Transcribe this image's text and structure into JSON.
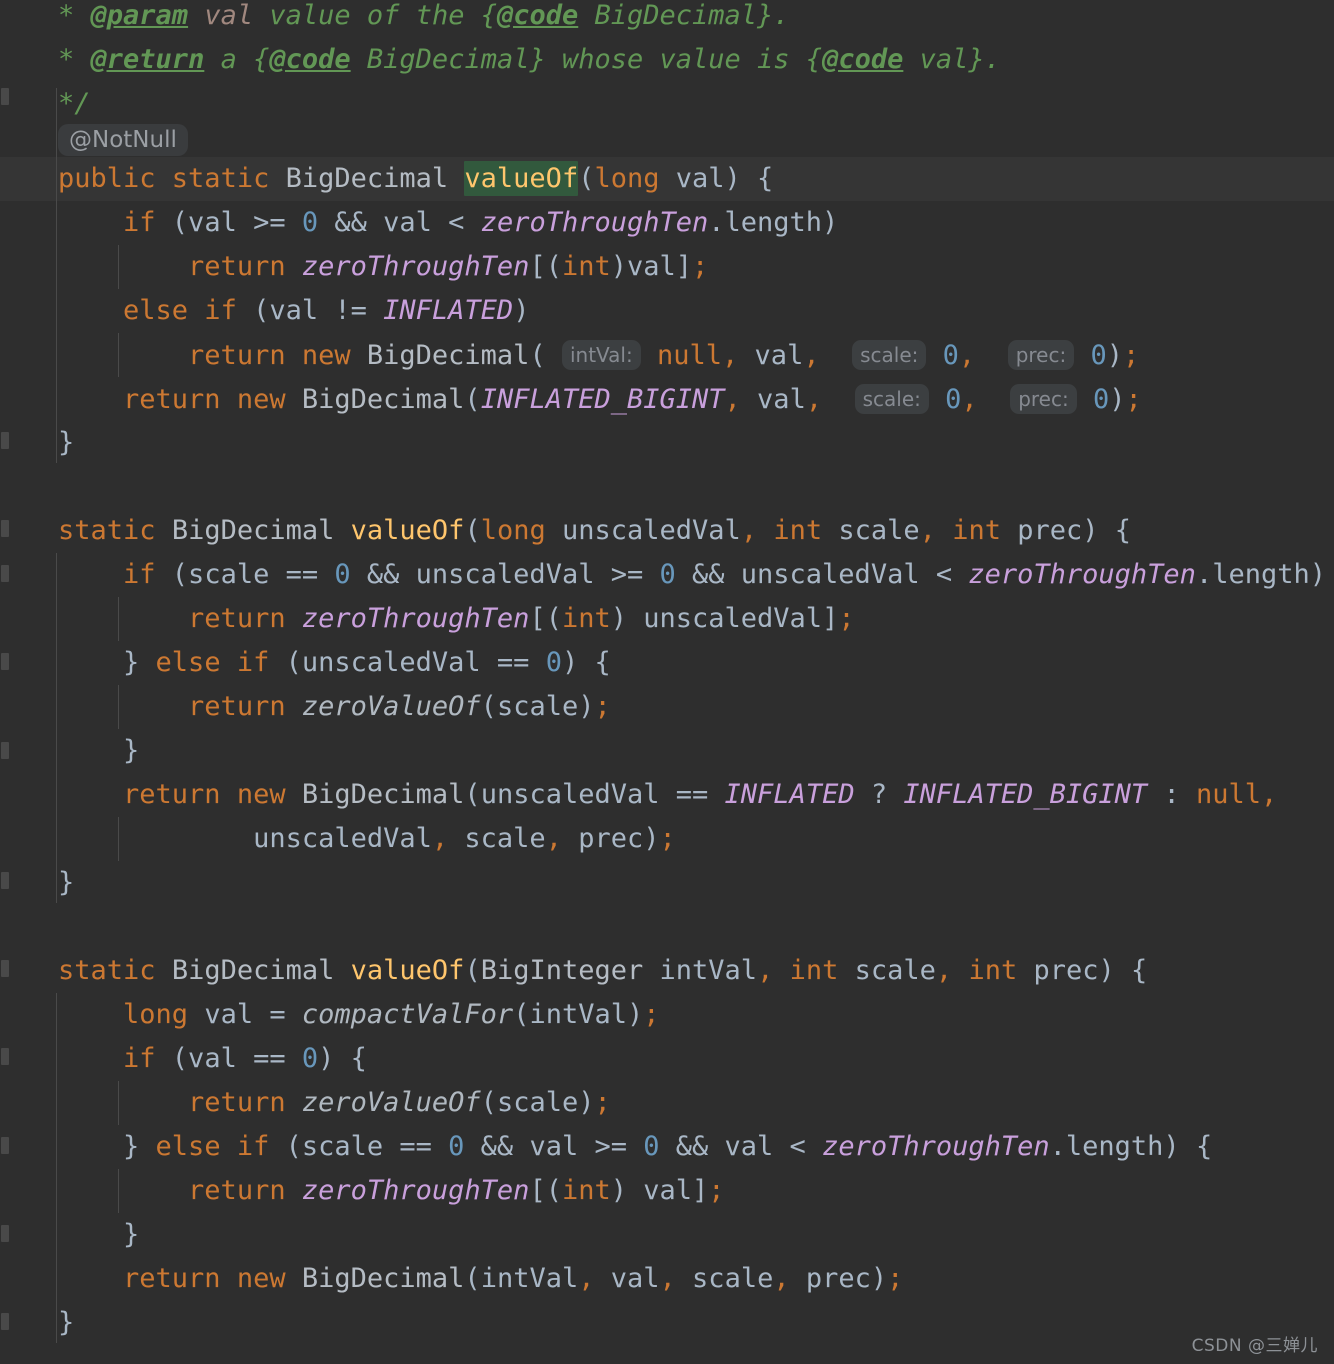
{
  "editor": {
    "theme": "darcula-dark",
    "background": "#2e2e2e",
    "caret_line_background": "#353535",
    "font_size_px": 27,
    "line_height_px": 44,
    "language": "Java",
    "file_context": "java.math.BigDecimal"
  },
  "colors": {
    "keyword": "#cc7832",
    "class_name": "#b5bcc4",
    "method_declaration": "#ffc66d",
    "static_field": "#c9a0dc",
    "static_method": "#b0b8c0",
    "number": "#6897bb",
    "comment": "#629755",
    "javadoc_param": "#a1887f",
    "plain_text": "#a9b7c6",
    "usage_highlight": "#32593d",
    "inlay_background": "#3c3f41",
    "inlay_text": "#868a91",
    "indent_guide": "#4a4a4a",
    "gutter_marker": "#5a5a5a"
  },
  "inlay_hints": {
    "annotation": "@NotNull",
    "param_intVal": "intVal:",
    "param_scale": "scale:",
    "param_prec": "prec:"
  },
  "code": {
    "javadoc": {
      "line1_star": "*",
      "line1_tag": "@param",
      "line1_param": "val",
      "line1_text_a": "value of the {",
      "line1_code_tag": "@code",
      "line1_text_b": " BigDecimal}.",
      "line2_star": "*",
      "line2_tag": "@return",
      "line2_text_a": "a {",
      "line2_code_tag": "@code",
      "line2_text_b": " BigDecimal} whose value is {",
      "line2_code_tag2": "@code",
      "line2_text_c": " val}.",
      "line3_close": "*/"
    },
    "method1": {
      "signature_modifiers": "public static ",
      "signature_type": "BigDecimal ",
      "signature_name": "valueOf",
      "signature_params": "(long val) {",
      "body": [
        "if (val >= 0 && val < zeroThroughTen.length)",
        "return zeroThroughTen[(int)val];",
        "else if (val != INFLATED)",
        "return new BigDecimal( intVal: null, val, scale: 0, prec: 0);",
        "return new BigDecimal(INFLATED_BIGINT, val, scale: 0, prec: 0);",
        "}"
      ]
    },
    "method2": {
      "signature": "static BigDecimal valueOf(long unscaledVal, int scale, int prec) {",
      "body": [
        "if (scale == 0 && unscaledVal >= 0 && unscaledVal < zeroThroughTen.length) {",
        "return zeroThroughTen[(int) unscaledVal];",
        "} else if (unscaledVal == 0) {",
        "return zeroValueOf(scale);",
        "}",
        "return new BigDecimal(unscaledVal == INFLATED ? INFLATED_BIGINT : null,",
        "unscaledVal, scale, prec);",
        "}"
      ]
    },
    "method3": {
      "signature": "static BigDecimal valueOf(BigInteger intVal, int scale, int prec) {",
      "body": [
        "long val = compactValFor(intVal);",
        "if (val == 0) {",
        "return zeroValueOf(scale);",
        "} else if (scale == 0 && val >= 0 && val < zeroThroughTen.length) {",
        "return zeroThroughTen[(int) val];",
        "}",
        "return new BigDecimal(intVal, val, scale, prec);",
        "}"
      ]
    }
  },
  "watermark": {
    "text": "CSDN @三婵儿"
  }
}
